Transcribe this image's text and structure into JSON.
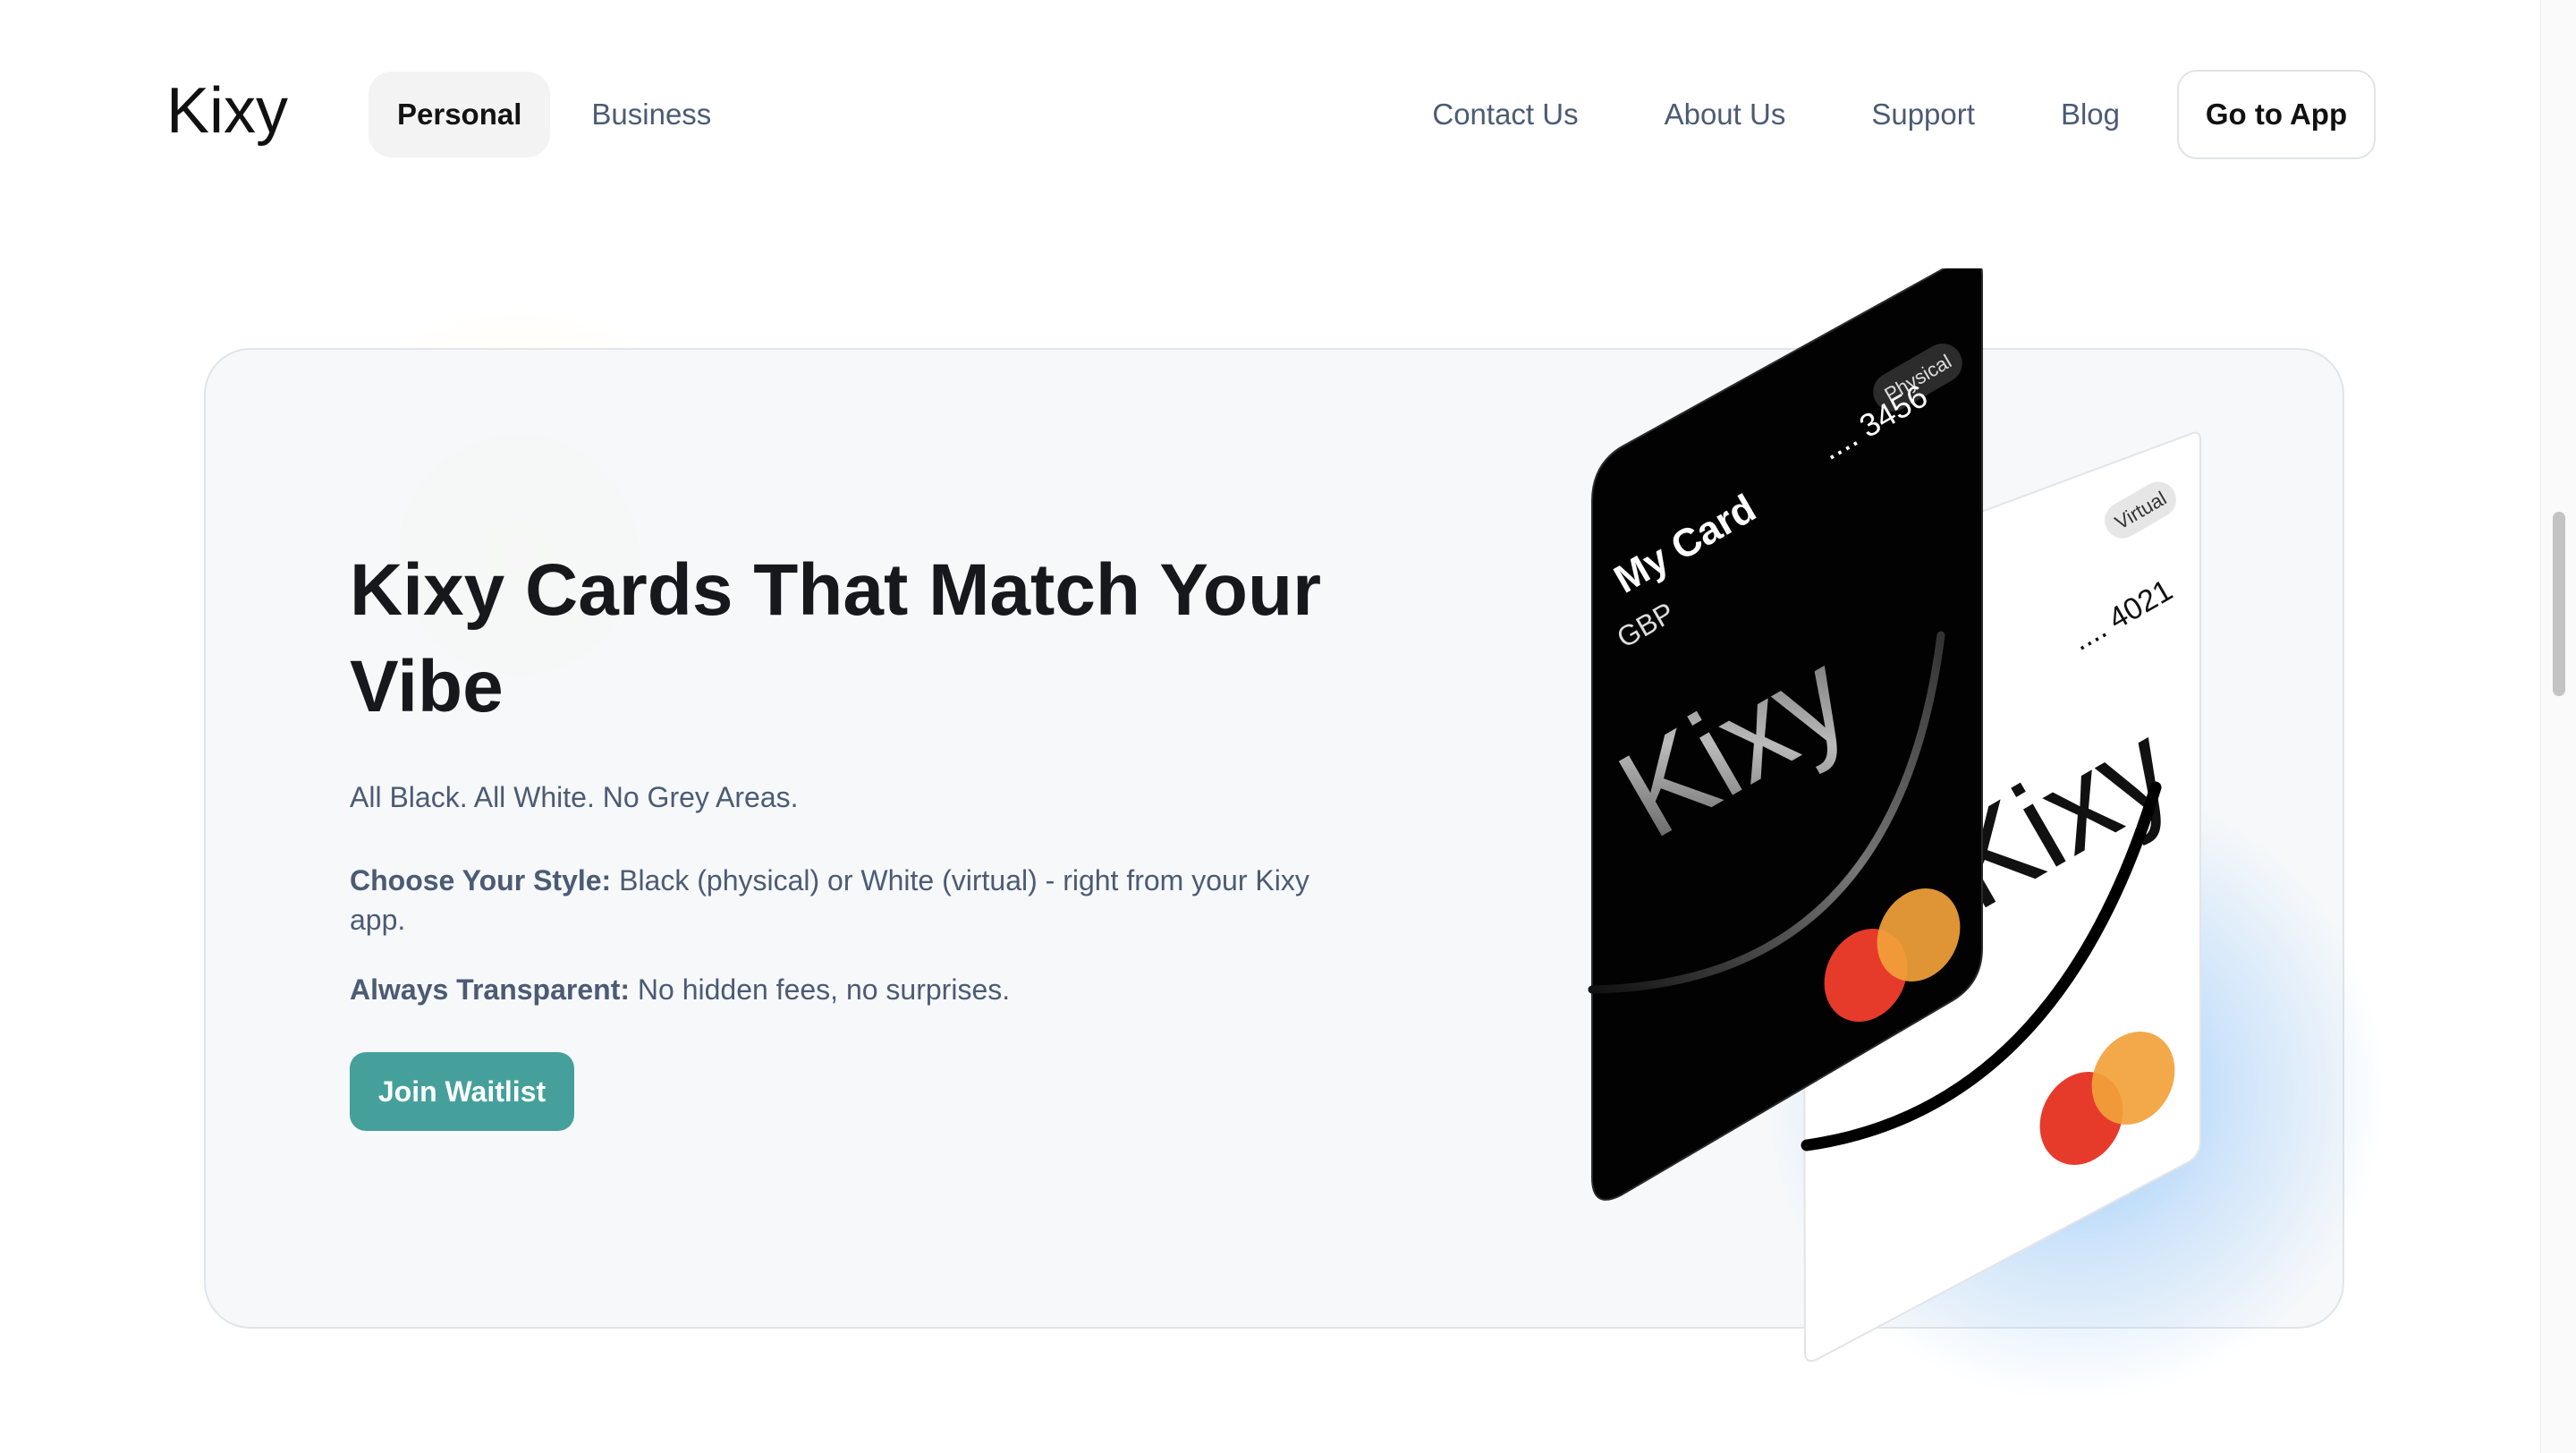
{
  "brand": {
    "logo_text": "Kixy",
    "accent_color": "#45a09b"
  },
  "nav": {
    "left": [
      {
        "label": "Personal",
        "active": true
      },
      {
        "label": "Business",
        "active": false
      }
    ],
    "right": [
      "Contact Us",
      "About Us",
      "Support",
      "Blog"
    ],
    "cta": "Go to App"
  },
  "hero": {
    "title": "Kixy Cards That Match Your Vibe",
    "subtitle": "All Black. All White. No Grey Areas.",
    "features": [
      {
        "label": "Choose Your Style:",
        "text": " Black (physical) or White (virtual) - right from your Kixy app."
      },
      {
        "label": "Always Transparent:",
        "text": " No hidden fees, no surprises."
      }
    ],
    "button": "Join Waitlist"
  },
  "cards": {
    "physical": {
      "badge": "Physical",
      "name": "My Card",
      "currency": "GBP",
      "number": ".... 3456",
      "brand": "Kixy",
      "color": "#000000"
    },
    "virtual": {
      "badge": "Virtual",
      "number": ".... 4021",
      "brand": "Kixy",
      "color": "#ffffff"
    }
  }
}
